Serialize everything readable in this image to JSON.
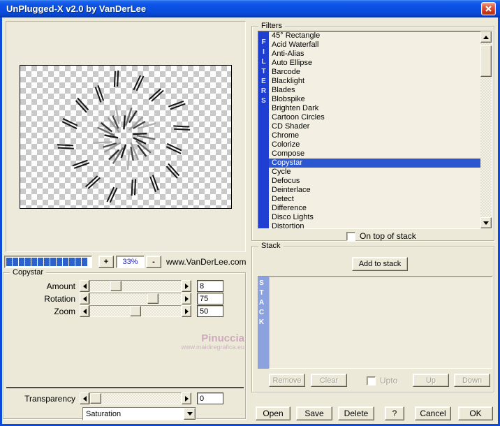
{
  "window": {
    "title": "UnPlugged-X v2.0 by VanDerLee"
  },
  "preview": {
    "zoom_in_label": "+",
    "zoom_out_label": "-",
    "zoom_percent": "33%",
    "website": "www.VanDerLee.com",
    "progress_segments": 13
  },
  "filters": {
    "group_label": "Filters",
    "strip_label": "FILTERS",
    "items": [
      "45° Rectangle",
      "Acid Waterfall",
      "Anti-Alias",
      "Auto Ellipse",
      "Barcode",
      "Blacklight",
      "Blades",
      "Blobspike",
      "Brighten Dark",
      "Cartoon Circles",
      "CD Shader",
      "Chrome",
      "Colorize",
      "Compose",
      "Copystar",
      "Cycle",
      "Defocus",
      "Deinterlace",
      "Detect",
      "Difference",
      "Disco Lights",
      "Distortion"
    ],
    "selected": "Copystar",
    "on_top_checkbox_label": "On top of stack",
    "on_top_checked": false
  },
  "params": {
    "group_label": "Copystar",
    "sliders": [
      {
        "label": "Amount",
        "value": "8",
        "fraction": 0.25
      },
      {
        "label": "Rotation",
        "value": "75",
        "fraction": 0.72
      },
      {
        "label": "Zoom",
        "value": "50",
        "fraction": 0.5
      }
    ],
    "transparency": {
      "label": "Transparency",
      "value": "0",
      "fraction": 0.0
    },
    "blend_mode": "Saturation"
  },
  "watermark": {
    "line1": "Pinuccia",
    "line2": "www.maidiregrafica.eu"
  },
  "stack": {
    "group_label": "Stack",
    "strip_label": "STACK",
    "add_button": "Add to stack",
    "remove_button": "Remove",
    "clear_button": "Clear",
    "upto_checkbox_label": "Upto",
    "upto_checked": false,
    "up_button": "Up",
    "down_button": "Down"
  },
  "footer": {
    "open": "Open",
    "save": "Save",
    "delete": "Delete",
    "help": "?",
    "cancel": "Cancel",
    "ok": "OK"
  },
  "colors": {
    "titlebar_blue": "#0c52e4",
    "selection_blue": "#2c55d0",
    "filters_strip_blue": "#1e3fd2",
    "stack_strip_blue": "#8ba2de",
    "progress_blue": "#2e62cb",
    "dialog_beige": "#ece9d8",
    "watermark_pink": "#c99fb6"
  }
}
